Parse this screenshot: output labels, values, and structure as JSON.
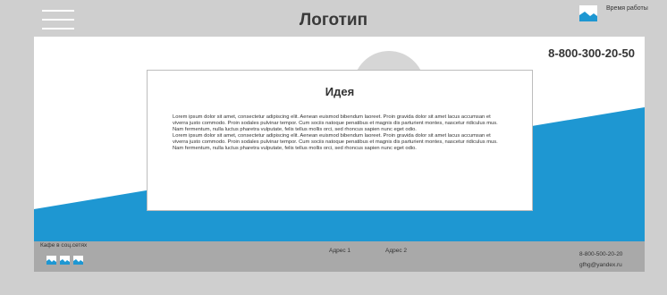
{
  "header": {
    "logo": "Логотип",
    "hours_label": "Время работы",
    "menu_icon": "hamburger-menu-icon",
    "hours_icon": "image-placeholder-icon"
  },
  "hero": {
    "phone": "8-800-300-20-50",
    "card": {
      "title": "Идея",
      "paragraphs": [
        "Lorem ipsum dolor sit amet, consectetur adipiscing elit. Aenean euismod bibendum laoreet. Proin gravida dolor sit amet lacus accumsan et viverra justo commodo. Proin sodales pulvinar tempor. Cum sociis natoque penatibus et magnis dis parturient montes, nascetur ridiculus mus. Nam fermentum, nulla luctus pharetra vulputate, felis tellus mollis orci, sed rhoncus sapien nunc eget odio.",
        "Lorem ipsum dolor sit amet, consectetur adipiscing elit. Aenean euismod bibendum laoreet. Proin gravida dolor sit amet lacus accumsan et viverra justo commodo. Proin sodales pulvinar tempor. Cum sociis natoque penatibus et magnis dis parturient montes, nascetur ridiculus mus. Nam fermentum, nulla luctus pharetra vulputate, felis tellus mollis orci, sed rhoncus sapien nunc eget odio."
      ]
    }
  },
  "footer": {
    "social_label": "Кафе в соц.сетях",
    "address_1": "Адрес 1",
    "address_2": "Адрес 2",
    "phone": "8-800-500-20-20",
    "email": "gfhg@yandex.ru",
    "social_icons": [
      "image-placeholder-icon",
      "image-placeholder-icon",
      "image-placeholder-icon"
    ]
  },
  "colors": {
    "accent_blue": "#1e97d2",
    "background_gray": "#cfcfcf",
    "footer_gray": "#a9a9a9",
    "circle_gray": "#d6d6d6"
  }
}
